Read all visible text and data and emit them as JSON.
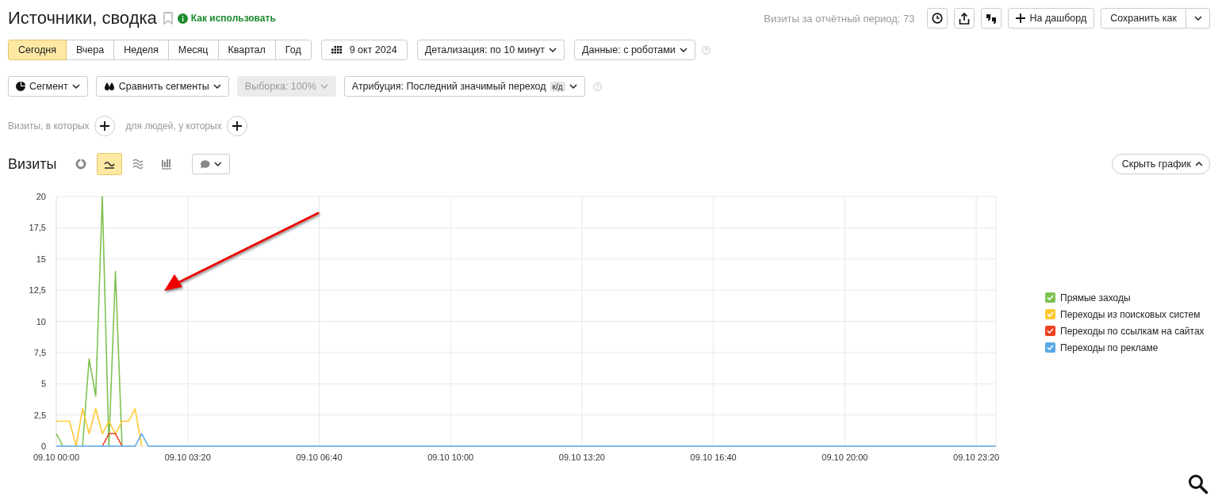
{
  "header": {
    "title": "Источники, сводка",
    "help_link": "Как использовать",
    "visits_total": "Визиты за отчётный период: 73",
    "dashboard_button": "На дашборд",
    "save_button": "Сохранить как"
  },
  "periods": [
    {
      "label": "Сегодня",
      "selected": true
    },
    {
      "label": "Вчера",
      "selected": false
    },
    {
      "label": "Неделя",
      "selected": false
    },
    {
      "label": "Месяц",
      "selected": false
    },
    {
      "label": "Квартал",
      "selected": false
    },
    {
      "label": "Год",
      "selected": false
    }
  ],
  "date_button": "9 окт 2024",
  "dropdowns": [
    "Детализация: по 10 минут",
    "Данные: с роботами"
  ],
  "segment_row": {
    "segment": "Сегмент",
    "compare": "Сравнить сегменты",
    "sample": {
      "label": "Выборка: 100%",
      "disabled": true
    },
    "attribution": {
      "label": "Атрибуция: Последний значимый переход",
      "badge": "к/д"
    }
  },
  "filters": {
    "visits_label": "Визиты, в которых",
    "people_label": "для людей, у которых"
  },
  "chart_section": {
    "title": "Визиты",
    "view_modes": [
      {
        "kind": "pie",
        "selected": false
      },
      {
        "kind": "line",
        "selected": true
      },
      {
        "kind": "area",
        "selected": false
      },
      {
        "kind": "bar",
        "selected": false
      }
    ],
    "hide_button": "Скрыть график",
    "legend": [
      {
        "checked": true
      },
      {
        "checked": true
      },
      {
        "checked": true
      },
      {
        "checked": true
      }
    ],
    "chart_data": {
      "type": "line",
      "grid": true,
      "ylim": [
        0,
        20
      ],
      "categories": [
        "09.10 00:00",
        null,
        null,
        null,
        null,
        null,
        null,
        null,
        null,
        null,
        null,
        null,
        null,
        null,
        null,
        null,
        null,
        null,
        null,
        null,
        "09.10 03:20",
        null,
        null,
        null,
        null,
        null,
        null,
        null,
        null,
        null,
        null,
        null,
        null,
        null,
        null,
        null,
        null,
        null,
        null,
        null,
        "09.10 06:40",
        null,
        null,
        null,
        null,
        null,
        null,
        null,
        null,
        null,
        null,
        null,
        null,
        null,
        null,
        null,
        null,
        null,
        null,
        null,
        "09.10 10:00",
        null,
        null,
        null,
        null,
        null,
        null,
        null,
        null,
        null,
        null,
        null,
        null,
        null,
        null,
        null,
        null,
        null,
        null,
        null,
        "09.10 13:20",
        null,
        null,
        null,
        null,
        null,
        null,
        null,
        null,
        null,
        null,
        null,
        null,
        null,
        null,
        null,
        null,
        null,
        null,
        null,
        "09.10 16:40",
        null,
        null,
        null,
        null,
        null,
        null,
        null,
        null,
        null,
        null,
        null,
        null,
        null,
        null,
        null,
        null,
        null,
        null,
        null,
        "09.10 20:00",
        null,
        null,
        null,
        null,
        null,
        null,
        null,
        null,
        null,
        null,
        null,
        null,
        null,
        null,
        null,
        null,
        null,
        null,
        null,
        "09.10 23:20",
        null,
        null,
        null
      ],
      "yticks": [
        0,
        {
          "value": 2.5,
          "label": "2,5"
        },
        5,
        {
          "value": 7.5,
          "label": "7,5"
        },
        10,
        {
          "value": 12.5,
          "label": "12,5"
        },
        15,
        {
          "value": 17.5,
          "label": "17,5"
        },
        20
      ],
      "series": [
        {
          "name": "Прямые заходы",
          "color": "#7ec251",
          "values": [
            1,
            0,
            null,
            null,
            0,
            7,
            4,
            20,
            0,
            14,
            0,
            null,
            null,
            null,
            null,
            null,
            null,
            null,
            null,
            null,
            null,
            null,
            null,
            null,
            null,
            null,
            null,
            null,
            null,
            null,
            null,
            null,
            null,
            null,
            null,
            null,
            null,
            null,
            null,
            null,
            null,
            null,
            null,
            null,
            null,
            null,
            null,
            null,
            null,
            null,
            null,
            null,
            null,
            null,
            null,
            null,
            null,
            null,
            null,
            null,
            null,
            null,
            null,
            null,
            null,
            null,
            null,
            null,
            null,
            null,
            null,
            null,
            null,
            null,
            null,
            null,
            null,
            null,
            null,
            null,
            null,
            null,
            null,
            null,
            null,
            null,
            null,
            null,
            null,
            null,
            null,
            null,
            null,
            null,
            null,
            null,
            null,
            null,
            null,
            null,
            null,
            null,
            null,
            null,
            null,
            null,
            null,
            null,
            null,
            null,
            null,
            null,
            null,
            null,
            null,
            null,
            null,
            null,
            null,
            null,
            null,
            null,
            null,
            null,
            null,
            null,
            null,
            null,
            null,
            null,
            null,
            null,
            null,
            null,
            null,
            null,
            null,
            null,
            null,
            null,
            null,
            null,
            null,
            null
          ]
        },
        {
          "name": "Переходы из поисковых систем",
          "color": "#ffc933",
          "values": [
            2,
            2,
            2,
            0,
            3,
            1,
            3,
            1,
            2,
            1,
            2,
            2,
            3,
            0,
            null,
            null,
            null,
            null,
            null,
            null,
            null,
            null,
            null,
            null,
            null,
            null,
            null,
            null,
            null,
            null,
            null,
            null,
            null,
            null,
            null,
            null,
            null,
            null,
            null,
            null,
            null,
            null,
            null,
            null,
            null,
            null,
            null,
            null,
            null,
            null,
            null,
            null,
            null,
            null,
            null,
            null,
            null,
            null,
            null,
            null,
            null,
            null,
            null,
            null,
            null,
            null,
            null,
            null,
            null,
            null,
            null,
            null,
            null,
            null,
            null,
            null,
            null,
            null,
            null,
            null,
            null,
            null,
            null,
            null,
            null,
            null,
            null,
            null,
            null,
            null,
            null,
            null,
            null,
            null,
            null,
            null,
            null,
            null,
            null,
            null,
            null,
            null,
            null,
            null,
            null,
            null,
            null,
            null,
            null,
            null,
            null,
            null,
            null,
            null,
            null,
            null,
            null,
            null,
            null,
            null,
            null,
            null,
            null,
            null,
            null,
            null,
            null,
            null,
            null,
            null,
            null,
            null,
            null,
            null,
            null,
            null,
            null,
            null,
            null,
            null,
            null,
            null,
            null,
            null
          ]
        },
        {
          "name": "Переходы по ссылкам на сайтах",
          "color": "#f0401f",
          "values": [
            null,
            null,
            null,
            null,
            null,
            null,
            null,
            0,
            1,
            1,
            0,
            null,
            null,
            null,
            null,
            null,
            null,
            null,
            null,
            null,
            null,
            null,
            null,
            null,
            null,
            null,
            null,
            null,
            null,
            null,
            null,
            null,
            null,
            null,
            null,
            null,
            null,
            null,
            null,
            null,
            null,
            null,
            null,
            null,
            null,
            null,
            null,
            null,
            null,
            null,
            null,
            null,
            null,
            null,
            null,
            null,
            null,
            null,
            null,
            null,
            null,
            null,
            null,
            null,
            null,
            null,
            null,
            null,
            null,
            null,
            null,
            null,
            null,
            null,
            null,
            null,
            null,
            null,
            null,
            null,
            null,
            null,
            null,
            null,
            null,
            null,
            null,
            null,
            null,
            null,
            null,
            null,
            null,
            null,
            null,
            null,
            null,
            null,
            null,
            null,
            null,
            null,
            null,
            null,
            null,
            null,
            null,
            null,
            null,
            null,
            null,
            null,
            null,
            null,
            null,
            null,
            null,
            null,
            null,
            null,
            null,
            null,
            null,
            null,
            null,
            null,
            null,
            null,
            null,
            null,
            null,
            null,
            null,
            null,
            null,
            null,
            null,
            null,
            null,
            null,
            null,
            null,
            null,
            null
          ]
        },
        {
          "name": "Переходы по рекламе",
          "color": "#5aa9e6",
          "values": [
            0,
            0,
            0,
            0,
            0,
            0,
            0,
            0,
            0,
            0,
            0,
            0,
            0,
            1,
            0,
            0,
            0,
            0,
            0,
            0,
            0,
            0,
            0,
            0,
            0,
            0,
            0,
            0,
            0,
            0,
            0,
            0,
            0,
            0,
            0,
            0,
            0,
            0,
            0,
            0,
            0,
            0,
            0,
            0,
            0,
            0,
            0,
            0,
            0,
            0,
            0,
            0,
            0,
            0,
            0,
            0,
            0,
            0,
            0,
            0,
            0,
            0,
            0,
            0,
            0,
            0,
            0,
            0,
            0,
            0,
            0,
            0,
            0,
            0,
            0,
            0,
            0,
            0,
            0,
            0,
            0,
            0,
            0,
            0,
            0,
            0,
            0,
            0,
            0,
            0,
            0,
            0,
            0,
            0,
            0,
            0,
            0,
            0,
            0,
            0,
            0,
            0,
            0,
            0,
            0,
            0,
            0,
            0,
            0,
            0,
            0,
            0,
            0,
            0,
            0,
            0,
            0,
            0,
            0,
            0,
            0,
            0,
            0,
            0,
            0,
            0,
            0,
            0,
            0,
            0,
            0,
            0,
            0,
            0,
            0,
            0,
            0,
            0,
            0,
            0,
            0,
            0,
            0,
            0
          ]
        }
      ]
    }
  }
}
